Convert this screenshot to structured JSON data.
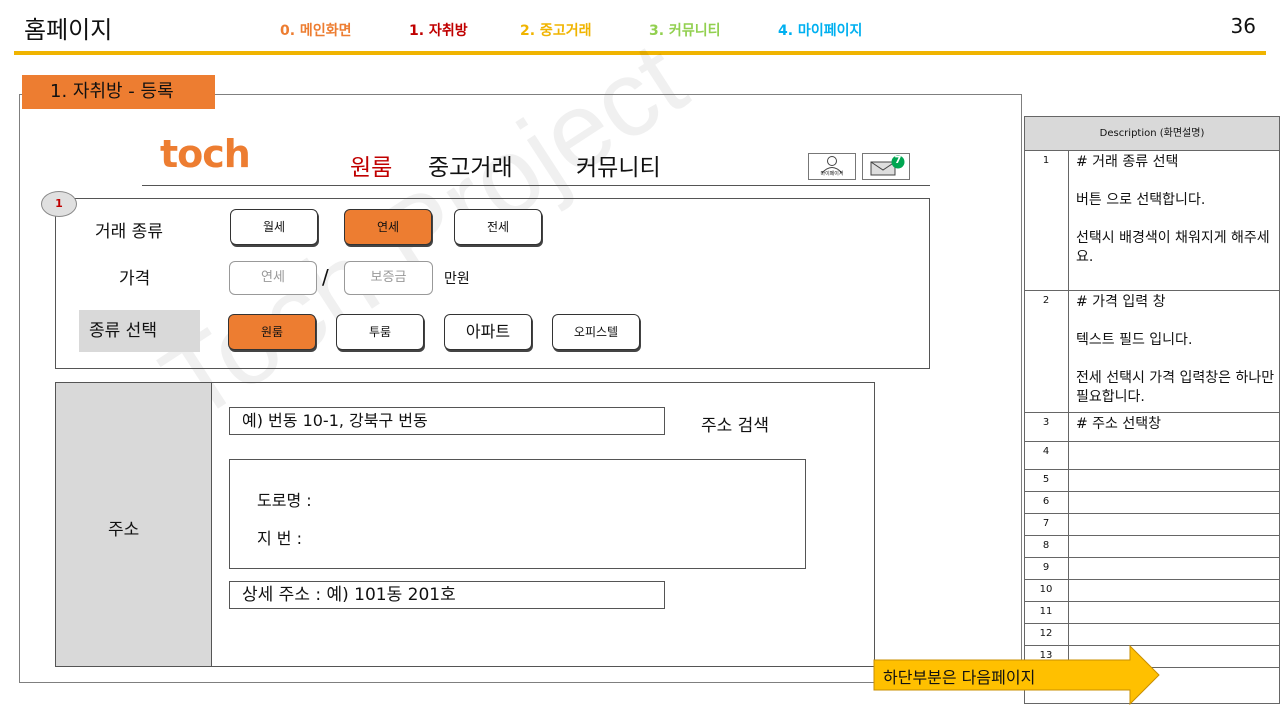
{
  "header": {
    "title": "홈페이지",
    "slide_number": "36",
    "nav": [
      {
        "label": "0. 메인화면",
        "color": "#ed7d31"
      },
      {
        "label": "1. 자취방",
        "color": "#c00000"
      },
      {
        "label": "2. 중고거래",
        "color": "#f0b400"
      },
      {
        "label": "3. 커뮤니티",
        "color": "#92d050"
      },
      {
        "label": "4. 마이페이지",
        "color": "#00b0f0"
      }
    ]
  },
  "section_tag": "1. 자취방 - 등록",
  "app": {
    "logo": "toch",
    "nav": [
      "원룸",
      "중고거래",
      "커뮤니티"
    ],
    "mypage_label": "마이페이지",
    "message_count": "7"
  },
  "form": {
    "badge": "1",
    "deal_type_label": "거래 종류",
    "deal_types": [
      "월세",
      "연세",
      "전세"
    ],
    "price_label": "가격",
    "price_placeholder_1": "연세",
    "price_separator": "/",
    "price_placeholder_2": "보증금",
    "price_unit": "만원",
    "kind_label": "종류 선택",
    "kinds": [
      "원룸",
      "투룸",
      "아파트",
      "오피스텔"
    ]
  },
  "address": {
    "label": "주소",
    "search_value": "예) 번동 10-1, 강북구 번동",
    "search_button": "주소 검색",
    "road_label": "도로명 :",
    "lot_label": "지 번 :",
    "detail_value": "상세 주소 : 예) 101동 201호"
  },
  "description": {
    "header": "Description (화면설명)",
    "rows": [
      {
        "num": "1",
        "text": "# 거래 종류 선택\n\n버튼 으로 선택합니다.\n\n선택시 배경색이 채워지게 해주세요."
      },
      {
        "num": "2",
        "text": "# 가격 입력 창\n\n텍스트 필드 입니다.\n\n전세 선택시 가격 입력창은 하나만 필요합니다."
      },
      {
        "num": "3",
        "text": "#  주소 선택창"
      },
      {
        "num": "4",
        "text": ""
      },
      {
        "num": "5",
        "text": ""
      },
      {
        "num": "6",
        "text": ""
      },
      {
        "num": "7",
        "text": ""
      },
      {
        "num": "8",
        "text": ""
      },
      {
        "num": "9",
        "text": ""
      },
      {
        "num": "10",
        "text": ""
      },
      {
        "num": "11",
        "text": ""
      },
      {
        "num": "12",
        "text": ""
      },
      {
        "num": "13",
        "text": ""
      }
    ]
  },
  "arrow_note": "하단부분은 다음페이지",
  "watermark": "Toch Project",
  "colors": {
    "accent": "#ed7d31",
    "header_rule": "#f0b400",
    "arrow": "#ffc000",
    "panel_gray": "#d9d9d9"
  }
}
